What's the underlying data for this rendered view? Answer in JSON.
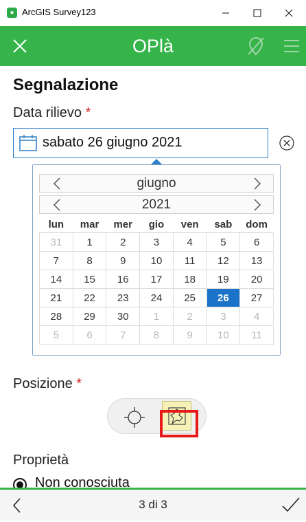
{
  "window": {
    "title": "ArcGIS Survey123"
  },
  "header": {
    "survey_title": "OPlà"
  },
  "form": {
    "section_title": "Segnalazione",
    "date": {
      "label": "Data rilievo",
      "required_mark": "*",
      "value": "sabato 26 giugno 2021",
      "calendar": {
        "month": "giugno",
        "year": "2021",
        "weekdays": [
          "lun",
          "mar",
          "mer",
          "gio",
          "ven",
          "sab",
          "dom"
        ],
        "weeks": [
          [
            "31",
            "1",
            "2",
            "3",
            "4",
            "5",
            "6"
          ],
          [
            "7",
            "8",
            "9",
            "10",
            "11",
            "12",
            "13"
          ],
          [
            "14",
            "15",
            "16",
            "17",
            "18",
            "19",
            "20"
          ],
          [
            "21",
            "22",
            "23",
            "24",
            "25",
            "26",
            "27"
          ],
          [
            "28",
            "29",
            "30",
            "1",
            "2",
            "3",
            "4"
          ],
          [
            "5",
            "6",
            "7",
            "8",
            "9",
            "10",
            "11"
          ]
        ],
        "selected_day": "26"
      }
    },
    "location": {
      "label": "Posizione",
      "required_mark": "*"
    },
    "property": {
      "label": "Proprietà",
      "option_label": "Non conosciuta"
    }
  },
  "footer": {
    "page_indicator": "3 di 3"
  },
  "colors": {
    "header": "#36b44a",
    "selected": "#1a73c9",
    "required": "#c62828",
    "highlight": "#e61818"
  }
}
